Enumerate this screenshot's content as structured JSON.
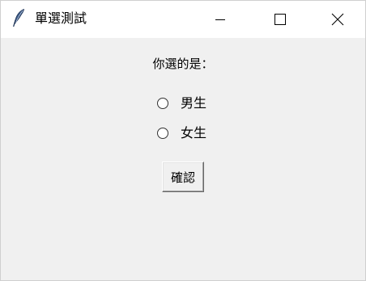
{
  "window": {
    "title": "單選測試",
    "controls": {
      "minimize": "minimize-icon",
      "maximize": "maximize-icon",
      "close": "close-icon"
    },
    "app_icon": "feather-icon"
  },
  "form": {
    "prompt": "你選的是：",
    "options": [
      {
        "label": "男生",
        "selected": false
      },
      {
        "label": "女生",
        "selected": false
      }
    ],
    "confirm_label": "確認"
  },
  "colors": {
    "titlebar_bg": "#ffffff",
    "client_bg": "#f0f0f0",
    "text": "#000000"
  }
}
